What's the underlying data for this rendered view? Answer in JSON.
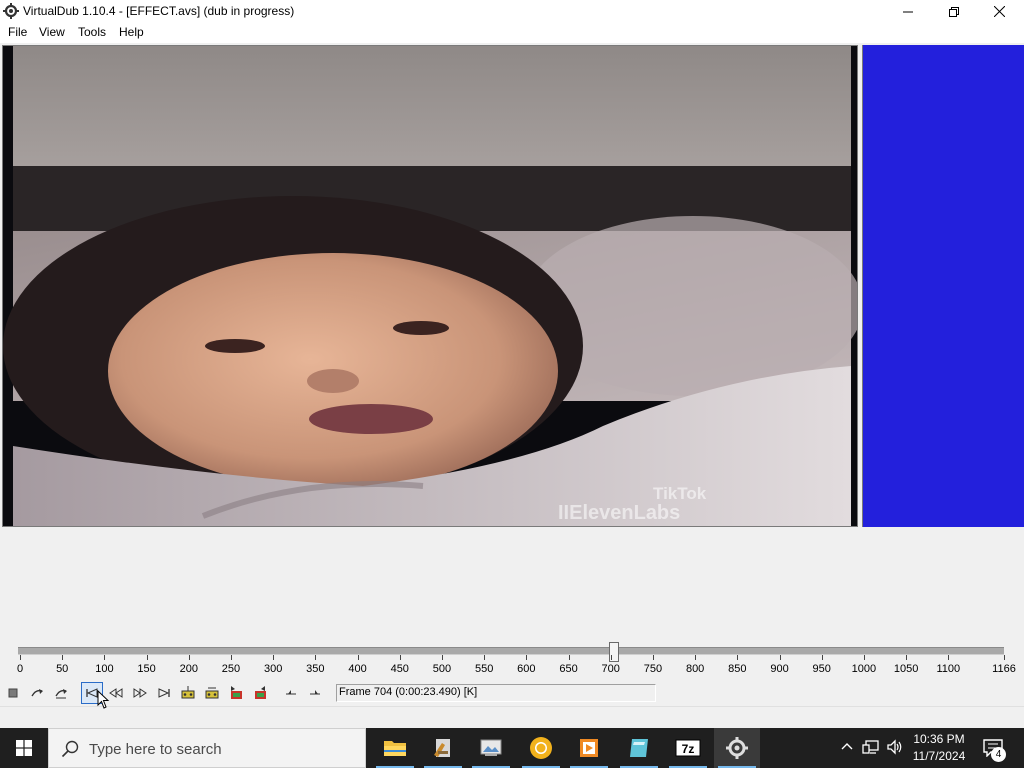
{
  "window": {
    "title": "VirtualDub 1.10.4 - [EFFECT.avs] (dub in progress)",
    "controls": [
      "minimize",
      "restore",
      "close"
    ]
  },
  "menu": {
    "items": [
      {
        "label": "File"
      },
      {
        "label": "View"
      },
      {
        "label": "Tools"
      },
      {
        "label": "Help"
      }
    ]
  },
  "video": {
    "watermark_line1": "TikTok",
    "watermark_line2": "IIElevenLabs",
    "output_pane_color": "#2320dc"
  },
  "timeline": {
    "min": 0,
    "max": 1166,
    "current_frame": 704,
    "tick_labels": [
      "0",
      "50",
      "100",
      "150",
      "200",
      "250",
      "300",
      "350",
      "400",
      "450",
      "500",
      "550",
      "600",
      "650",
      "700",
      "750",
      "800",
      "850",
      "900",
      "950",
      "1000",
      "1050",
      "1100",
      "1166"
    ]
  },
  "toolbar": {
    "buttons": [
      {
        "name": "stop-button",
        "icon": "stop-icon"
      },
      {
        "name": "play-input-button",
        "icon": "play-input-icon"
      },
      {
        "name": "play-output-button",
        "icon": "play-output-icon"
      },
      {
        "name": "go-to-start-button",
        "icon": "go-to-start-icon",
        "active": true
      },
      {
        "name": "previous-frame-button",
        "icon": "previous-frame-icon"
      },
      {
        "name": "next-frame-button",
        "icon": "next-frame-icon"
      },
      {
        "name": "go-to-end-button",
        "icon": "go-to-end-icon"
      },
      {
        "name": "previous-keyframe-button",
        "icon": "previous-keyframe-icon"
      },
      {
        "name": "next-keyframe-button",
        "icon": "next-keyframe-icon"
      },
      {
        "name": "scene-back-button",
        "icon": "scene-back-icon"
      },
      {
        "name": "scene-forward-button",
        "icon": "scene-forward-icon"
      },
      {
        "name": "mark-in-button",
        "icon": "mark-in-icon"
      },
      {
        "name": "mark-out-button",
        "icon": "mark-out-icon"
      }
    ],
    "frame_status": "Frame 704 (0:00:23.490) [K]"
  },
  "taskbar": {
    "search_placeholder": "Type here to search",
    "apps": [
      {
        "name": "file-explorer",
        "running": true
      },
      {
        "name": "app-2",
        "running": true
      },
      {
        "name": "app-3",
        "running": true
      },
      {
        "name": "browser",
        "running": true
      },
      {
        "name": "media-player",
        "running": true
      },
      {
        "name": "app-6",
        "running": true
      },
      {
        "name": "7zip",
        "running": true
      },
      {
        "name": "virtualdub",
        "running": true,
        "active": true
      }
    ],
    "time": "10:36 PM",
    "date": "11/7/2024",
    "notification_count": "4"
  }
}
